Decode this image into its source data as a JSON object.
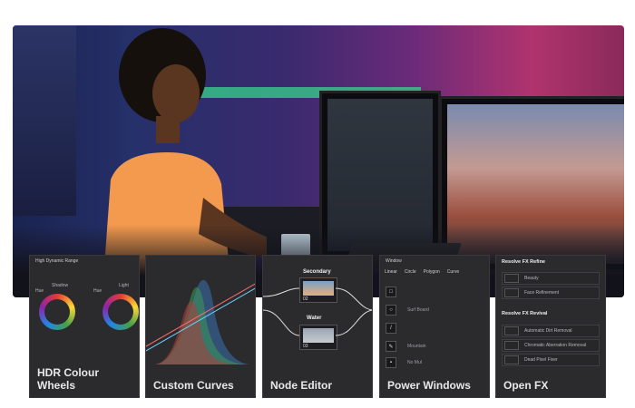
{
  "cards": [
    {
      "title": "HDR Colour Wheels",
      "panel_title": "High Dynamic Range",
      "wheel_labels": [
        "Shadow",
        "Light"
      ],
      "sub_labels": [
        "Hue",
        "Hue"
      ]
    },
    {
      "title": "Custom Curves"
    },
    {
      "title": "Node Editor",
      "nodes": [
        {
          "label": "Secondary",
          "id": "02"
        },
        {
          "label": "Water",
          "id": "03"
        }
      ]
    },
    {
      "title": "Power Windows",
      "panel_title": "Window",
      "shape_tabs": [
        "Linear",
        "Circle",
        "Polygon",
        "Curve"
      ],
      "rows": [
        "",
        "Surf Board",
        "",
        "Mountain",
        "No Mul"
      ]
    },
    {
      "title": "Open FX",
      "sections": [
        {
          "heading": "Resolve FX Refine",
          "items": [
            "Beauty",
            "Face Refinement"
          ]
        },
        {
          "heading": "Resolve FX Revival",
          "items": [
            "Automatic Dirt Removal",
            "Chromatic Aberration Removal",
            "Dead Pixel Fixer"
          ]
        }
      ]
    }
  ],
  "colors": {
    "card_bg": "#2b2b2e",
    "caption": "#e8e8ea"
  }
}
